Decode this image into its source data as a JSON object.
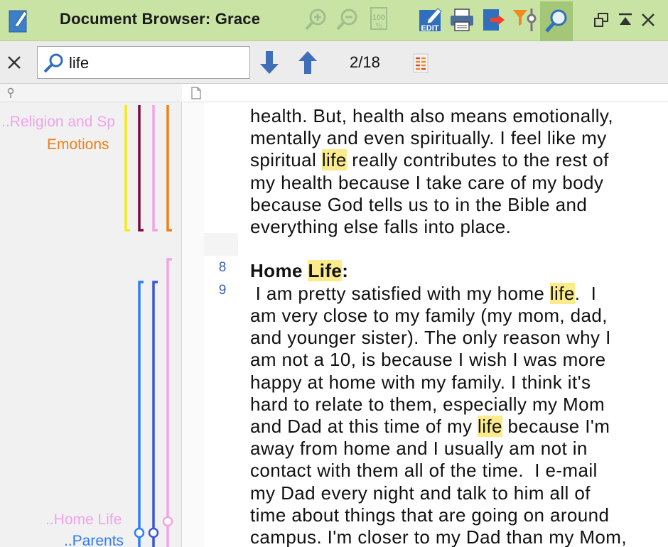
{
  "window": {
    "title": "Document Browser: Grace"
  },
  "toolbar": {
    "icons": [
      "zoom-in-icon",
      "zoom-out-icon",
      "100-percent-icon",
      "edit-icon",
      "print-icon",
      "export-icon",
      "filter-icon",
      "search-icon"
    ],
    "edit_badge": "EDIT",
    "hundred_label": "100",
    "hundred_sub": "%"
  },
  "search": {
    "value": "life",
    "counter": "2/18"
  },
  "codes": {
    "religion": "..Religion and Sp",
    "emotions": "Emotions",
    "home_life": "..Home Life",
    "parents": "..Parents"
  },
  "colors": {
    "religion": "#f2a3ea",
    "emotions": "#f07f16",
    "home_life": "#f2a3ea",
    "parents": "#2f7df7",
    "yellow": "#f5ec12",
    "maroon": "#7a0a3c",
    "blue_dark": "#3b55d6",
    "highlight": "#fbeb8a"
  },
  "line_numbers": [
    "8",
    "9"
  ],
  "document": {
    "para1": [
      "health. But, health also means emotionally,",
      "mentally and even spiritually. I feel like my",
      [
        "spiritual ",
        "life",
        " really contributes to the rest of"
      ],
      "my health because I take care of my body",
      "because God tells us to in the Bible and",
      "everything else falls into place."
    ],
    "heading_pre": "Home ",
    "heading_hl": "Life",
    "heading_post": ":",
    "para2": [
      [
        " I am pretty satisfied with my home ",
        "life",
        ".  I"
      ],
      "am very close to my family (my mom, dad,",
      "and younger sister). The only reason why I",
      "am not a 10, is because I wish I was more",
      "happy at home with my family. I think it's",
      "hard to relate to them, especially my Mom",
      [
        "and Dad at this time of my ",
        "life",
        " because I'm"
      ],
      "away from home and I usually am not in",
      "contact with them all of the time.  I e-mail",
      "my Dad every night and talk to him all of",
      "time about things that are going on around",
      "campus. I'm closer to my Dad than my Mom,"
    ]
  }
}
